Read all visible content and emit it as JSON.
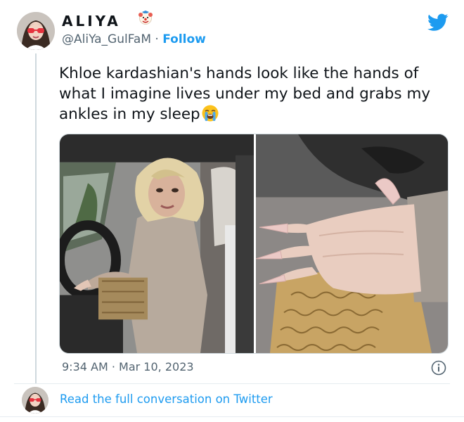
{
  "tweet": {
    "author": {
      "display_name": "ALIYA",
      "handle": "@AliYa_GulFaM",
      "separator": "·",
      "follow_label": "Follow",
      "name_emoji": "clown-face-icon"
    },
    "text": "Khloe kardashian's hands look like the hands of what I imagine lives under my bed and grabs my ankles in my sleep",
    "text_emoji": "loudly-crying-face-icon",
    "timestamp": "9:34 AM · Mar 10, 2023",
    "media": [
      "photo-woman-in-car",
      "photo-hands-closeup"
    ]
  },
  "footer": {
    "read_link": "Read the full conversation on Twitter"
  },
  "colors": {
    "twitter_blue": "#1d9bf0",
    "text_primary": "#0f1419",
    "text_secondary": "#536471",
    "border": "#cfd9de"
  }
}
